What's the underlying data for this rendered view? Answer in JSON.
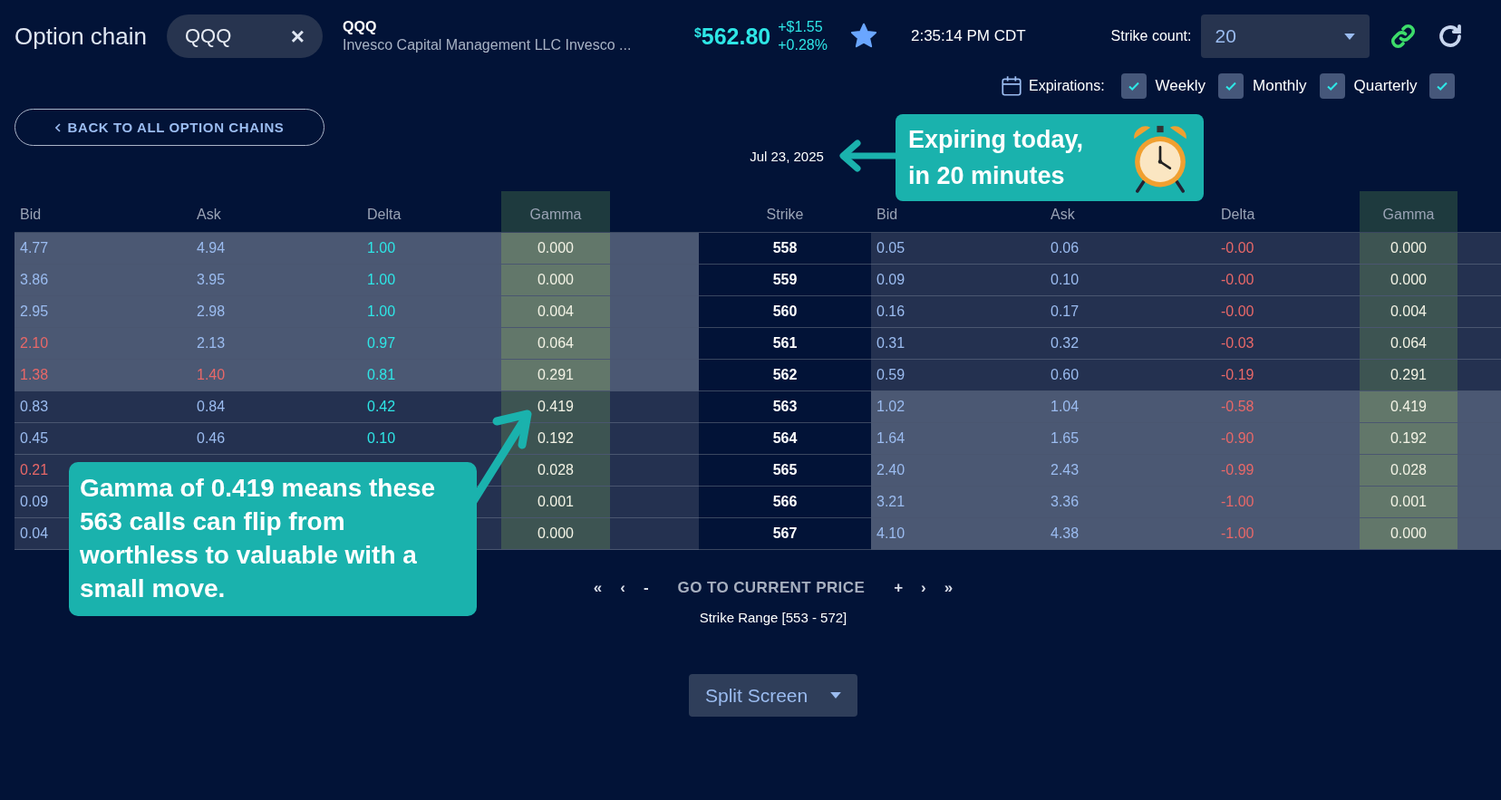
{
  "header": {
    "title": "Option chain",
    "symbol_field": {
      "value": "QQQ",
      "clear": "×"
    },
    "ticker": "QQQ",
    "company": "Invesco Capital Management LLC Invesco ...",
    "currency": "$",
    "price": "562.80",
    "change": "+$1.55",
    "change_pct": "+0.28%",
    "favorite": true,
    "time": "2:35:14 PM CDT",
    "strike_count_label": "Strike count:",
    "strike_count": "20"
  },
  "expirations": {
    "label": "Expirations:",
    "items": [
      {
        "label": "Weekly",
        "checked": true
      },
      {
        "label": "Monthly",
        "checked": true
      },
      {
        "label": "Quarterly",
        "checked": true
      },
      {
        "checked": true
      }
    ]
  },
  "back_button": "BACK TO ALL OPTION CHAINS",
  "date": "Jul 23, 2025",
  "table": {
    "call_columns": [
      "Bid",
      "Ask",
      "Delta",
      "Gamma"
    ],
    "strike_column": "Strike",
    "put_columns": [
      "Bid",
      "Ask",
      "Delta",
      "Gamma"
    ],
    "rows": [
      {
        "strike": "558",
        "call": {
          "itm": true,
          "bid": "4.77",
          "ask": "4.94",
          "delta": "1.00",
          "gamma": "0.000"
        },
        "put": {
          "itm": false,
          "bid": "0.05",
          "ask": "0.06",
          "delta": "-0.00",
          "gamma": "0.000"
        }
      },
      {
        "strike": "559",
        "call": {
          "itm": true,
          "bid": "3.86",
          "ask": "3.95",
          "delta": "1.00",
          "gamma": "0.000"
        },
        "put": {
          "itm": false,
          "bid": "0.09",
          "ask": "0.10",
          "delta": "-0.00",
          "gamma": "0.000"
        }
      },
      {
        "strike": "560",
        "call": {
          "itm": true,
          "bid": "2.95",
          "ask": "2.98",
          "delta": "1.00",
          "gamma": "0.004"
        },
        "put": {
          "itm": false,
          "bid": "0.16",
          "ask": "0.17",
          "delta": "-0.00",
          "gamma": "0.004"
        }
      },
      {
        "strike": "561",
        "call": {
          "itm": true,
          "bid": "2.10",
          "bid_down": true,
          "ask": "2.13",
          "delta": "0.97",
          "gamma": "0.064"
        },
        "put": {
          "itm": false,
          "bid": "0.31",
          "ask": "0.32",
          "delta": "-0.03",
          "gamma": "0.064"
        }
      },
      {
        "strike": "562",
        "call": {
          "itm": true,
          "bid": "1.38",
          "bid_down": true,
          "ask": "1.40",
          "ask_down": true,
          "delta": "0.81",
          "gamma": "0.291"
        },
        "put": {
          "itm": false,
          "bid": "0.59",
          "ask": "0.60",
          "delta": "-0.19",
          "gamma": "0.291"
        }
      },
      {
        "strike": "563",
        "call": {
          "itm": false,
          "bid": "0.83",
          "ask": "0.84",
          "delta": "0.42",
          "gamma": "0.419"
        },
        "put": {
          "itm": true,
          "bid": "1.02",
          "ask": "1.04",
          "delta": "-0.58",
          "gamma": "0.419"
        }
      },
      {
        "strike": "564",
        "call": {
          "itm": false,
          "bid": "0.45",
          "ask": "0.46",
          "delta": "0.10",
          "gamma": "0.192"
        },
        "put": {
          "itm": true,
          "bid": "1.64",
          "ask": "1.65",
          "delta": "-0.90",
          "gamma": "0.192"
        }
      },
      {
        "strike": "565",
        "call": {
          "itm": false,
          "bid": "0.21",
          "bid_down": true,
          "gamma": "0.028"
        },
        "put": {
          "itm": true,
          "bid": "2.40",
          "ask": "2.43",
          "delta": "-0.99",
          "gamma": "0.028"
        }
      },
      {
        "strike": "566",
        "call": {
          "itm": false,
          "bid": "0.09",
          "gamma": "0.001"
        },
        "put": {
          "itm": true,
          "bid": "3.21",
          "ask": "3.36",
          "delta": "-1.00",
          "gamma": "0.001"
        }
      },
      {
        "strike": "567",
        "call": {
          "itm": false,
          "bid": "0.04",
          "gamma": "0.000"
        },
        "put": {
          "itm": true,
          "bid": "4.10",
          "ask": "4.38",
          "delta": "-1.00",
          "gamma": "0.000"
        }
      }
    ]
  },
  "pagination": {
    "first": "«",
    "prev": "‹",
    "minus": "-",
    "current": "GO TO CURRENT PRICE",
    "plus": "+",
    "next": "›",
    "last": "»"
  },
  "strike_range": "Strike Range [553 - 572]",
  "view_select": "Split Screen",
  "annotations": [
    {
      "kind": "expiry",
      "text": "Expiring today, in 20 minutes"
    },
    {
      "kind": "gamma",
      "text": "Gamma of 0.419 means these 563 calls can flip from worthless to valuable with a small move."
    }
  ]
}
